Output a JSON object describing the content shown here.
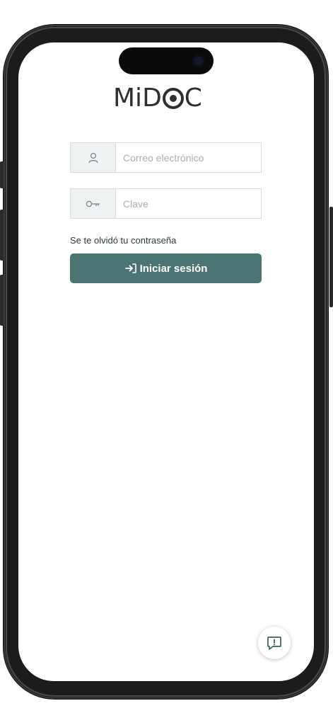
{
  "app": {
    "logo_text_left": "MiD",
    "logo_text_right": "C"
  },
  "login": {
    "email_placeholder": "Correo electrónico",
    "password_placeholder": "Clave",
    "forgot_link": "Se te olvidó tu contraseña",
    "submit_label": "Iniciar sesión"
  },
  "icons": {
    "user": "user-icon",
    "key": "key-icon",
    "login": "login-arrow-icon",
    "feedback": "feedback-icon"
  },
  "colors": {
    "accent": "#4b7472",
    "addon_bg": "#eef2f2",
    "frame": "#1c1c1e"
  }
}
